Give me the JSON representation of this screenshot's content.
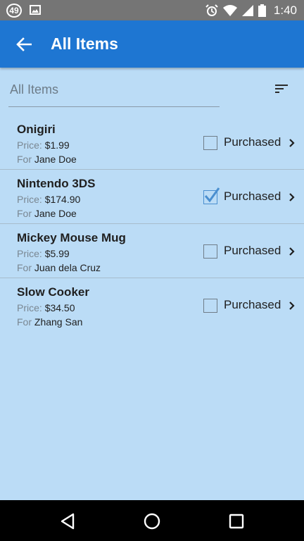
{
  "status_bar": {
    "badge": "49",
    "time": "1:40",
    "icons": [
      "image-icon",
      "alarm-icon",
      "wifi-icon",
      "signal-icon",
      "battery-icon"
    ]
  },
  "app_bar": {
    "title": "All Items",
    "back_icon": "arrow-back-icon"
  },
  "filter": {
    "label": "All Items",
    "sort_icon": "sort-icon"
  },
  "items": [
    {
      "name": "Onigiri",
      "price_label": "Price:",
      "price": "$1.99",
      "for_label": "For",
      "recipient": "Jane Doe",
      "purchased_label": "Purchased",
      "purchased": false
    },
    {
      "name": "Nintendo 3DS",
      "price_label": "Price:",
      "price": "$174.90",
      "for_label": "For",
      "recipient": "Jane Doe",
      "purchased_label": "Purchased",
      "purchased": true
    },
    {
      "name": "Mickey Mouse Mug",
      "price_label": "Price:",
      "price": "$5.99",
      "for_label": "For",
      "recipient": "Juan dela Cruz",
      "purchased_label": "Purchased",
      "purchased": false
    },
    {
      "name": "Slow Cooker",
      "price_label": "Price:",
      "price": "$34.50",
      "for_label": "For",
      "recipient": "Zhang San",
      "purchased_label": "Purchased",
      "purchased": false
    }
  ],
  "colors": {
    "app_bar": "#1e76d2",
    "background": "#bbdcf6",
    "status_bar": "#757575",
    "check_accent": "#4a8fd0"
  },
  "nav": [
    "back-icon",
    "home-icon",
    "recents-icon"
  ]
}
